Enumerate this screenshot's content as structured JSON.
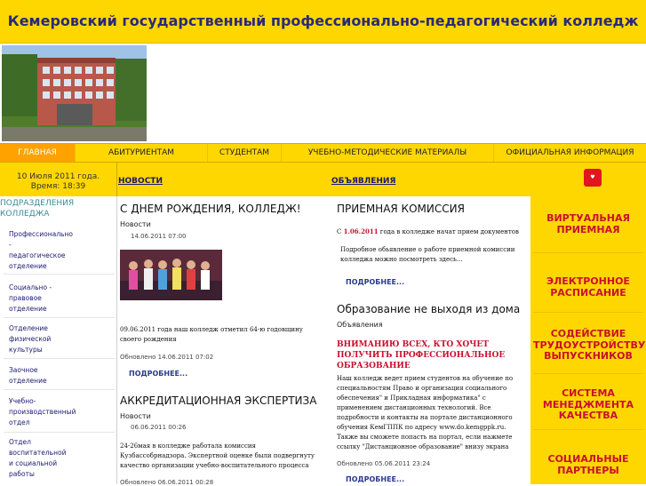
{
  "header": {
    "title": "Кемеровский государственный профессионально-педагогический колледж"
  },
  "nav": {
    "items": [
      {
        "label": "ГЛАВНАЯ"
      },
      {
        "label": "АБИТУРИЕНТАМ"
      },
      {
        "label": "СТУДЕНТАМ"
      },
      {
        "label": "УЧЕБНО-МЕТОДИЧЕСКИЕ МАТЕРИАЛЫ"
      },
      {
        "label": "ОФИЦИАЛЬНАЯ ИНФОРМАЦИЯ"
      }
    ]
  },
  "date": {
    "line1": "10 Июля 2011 года.",
    "line2": "Время: 18:39"
  },
  "tabs": {
    "news": "НОВОСТИ",
    "ads": "ОБЪЯВЛЕНИЯ"
  },
  "sidebar": {
    "heading": "ПОДРАЗДЕЛЕНИЯ КОЛЛЕДЖА",
    "items": [
      "Профессионально - педагогическое отделение",
      "Социально - правовое отделение",
      "Отделение физической культуры",
      "Заочное отделение",
      "Учебно- производственный отдел",
      "Отдел воспитательной и социальной работы"
    ]
  },
  "news": [
    {
      "title": "С ДНЕМ РОЖДЕНИЯ, КОЛЛЕДЖ!",
      "category": "Новости",
      "date": "14.06.2011 07:00",
      "body": "09.06.2011 года наш колледж отметил 64-ю годовщину своего рождения",
      "updated": "Обновлено 14.06.2011 07:02",
      "more": "ПОДРОБНЕЕ..."
    },
    {
      "title": "АККРЕДИТАЦИОННАЯ ЭКСПЕРТИЗА",
      "category": "Новости",
      "date": "06.06.2011 00:26",
      "body": "24-26мая в колледже работала комиссия Кузбассобрнадзора. Экспертной оценке были подвергнуту качество организации учебно-воспитательного процесса",
      "updated": "Обновлено 06.06.2011 00:28"
    }
  ],
  "ads": [
    {
      "title": "ПРИЕМНАЯ КОМИССИЯ",
      "body_prefix": "С ",
      "body_date": "1.06.2011",
      "body_suffix": " года в колледже начат прием документов",
      "body2": "Подробное обьявление о работе приемной комиссии колледжа можно посмотреть здесь...",
      "more": "ПОДРОБНЕЕ..."
    },
    {
      "title": "Образование не выходя из дома",
      "category": "Объявления",
      "highlight": "ВНИМАНИЮ ВСЕХ, КТО ХОЧЕТ ПОЛУЧИТЬ ПРОФЕССИОНАЛЬНОЕ ОБРАЗОВАНИЕ",
      "body": "Наш колледж ведет прием студентов на обучение по специальностям Право и организация социального обеспечения\" и Прикладная информатика\" с применением дистанционных технологий. Все подробности и контакты на портале дистанционного обучения КемГППК по адресу www.do.kemgppk.ru. Также вы сможете попасть на портал, если нажмете ссылку \"Дистанционное образование\" внизу экрана",
      "updated": "Обновлено 05.06.2011 23:24",
      "more": "ПОДРОБНЕЕ..."
    }
  ],
  "right_buttons": [
    "ВИРТУАЛЬНАЯ ПРИЕМНАЯ",
    "ЭЛЕКТРОННОЕ РАСПИСАНИЕ",
    "СОДЕЙСТВИЕ ТРУДОУСТРОЙСТВУ ВЫПУСКНИКОВ",
    "СИСТЕМА МЕНЕДЖМЕНТА КАЧЕСТВА",
    "СОЦИАЛЬНЫЕ ПАРТНЕРЫ"
  ],
  "colors": {
    "yellow": "#ffd700",
    "orange_active": "#ffa200",
    "red": "#c8102e",
    "link": "#1a1a6e"
  },
  "icons": {
    "social": "logo-icon"
  }
}
